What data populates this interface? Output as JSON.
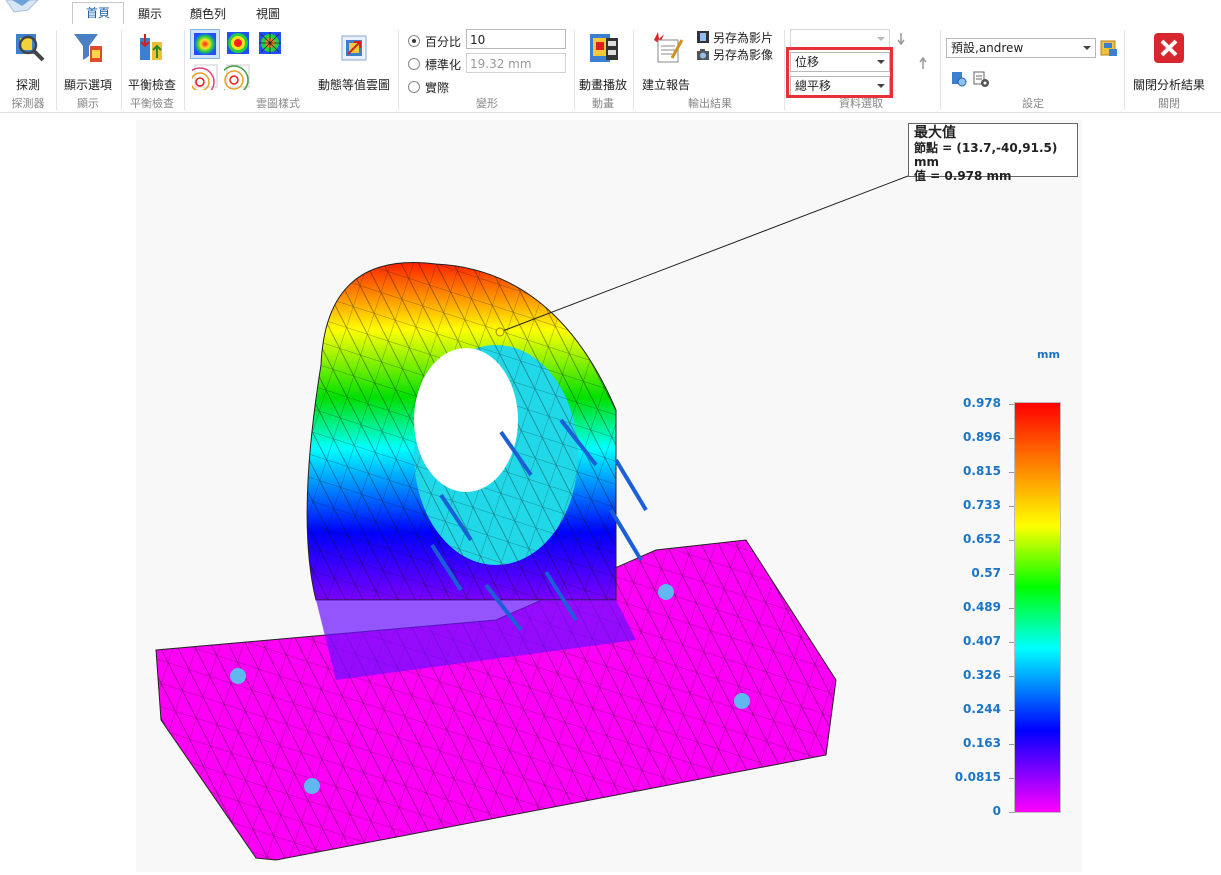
{
  "tabs": [
    "首頁",
    "顯示",
    "顏色列",
    "視圖"
  ],
  "active_tab": "首頁",
  "ribbon": {
    "probe": {
      "label": "探測",
      "group": "探測器"
    },
    "display": {
      "label": "顯示選項",
      "group": "顯示"
    },
    "balance": {
      "label": "平衡檢查",
      "group": "平衡檢查"
    },
    "contour": {
      "group": "雲圖樣式"
    },
    "dynamic": {
      "label": "動態等值雲圖"
    },
    "deformation": {
      "group": "變形",
      "options": [
        {
          "label": "百分比",
          "selected": true,
          "value": "10"
        },
        {
          "label": "標準化",
          "selected": false,
          "value": "19.32 mm"
        },
        {
          "label": "實際",
          "selected": false
        }
      ]
    },
    "animation": {
      "label": "動畫播放",
      "group": "動畫"
    },
    "report": {
      "label": "建立報告",
      "group": "輸出結果"
    },
    "save_video": "另存為影片",
    "save_image": "另存為影像",
    "data_selection": {
      "group": "資料選取",
      "top_combo": "",
      "result": "位移",
      "component": "總平移"
    },
    "settings": {
      "group": "設定",
      "profile": "預設,andrew"
    },
    "close": {
      "label": "關閉分析結果",
      "group": "關閉"
    }
  },
  "callout": {
    "title": "最大值",
    "node": "節點 = (13.7,-40,91.5) mm",
    "value": "值 = 0.978 mm"
  },
  "legend": {
    "unit": "mm",
    "values": [
      "0.978",
      "0.896",
      "0.815",
      "0.733",
      "0.652",
      "0.57",
      "0.489",
      "0.407",
      "0.326",
      "0.244",
      "0.163",
      "0.0815",
      "0"
    ],
    "colors": [
      "#ff0000",
      "#ff8000",
      "#ffff00",
      "#00ff00",
      "#00ffff",
      "#0000ff",
      "#ff00ff"
    ]
  }
}
